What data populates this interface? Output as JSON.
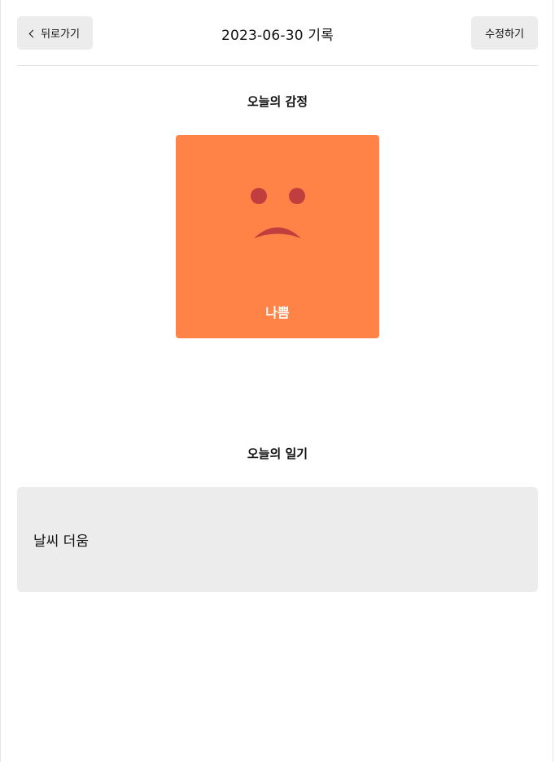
{
  "header": {
    "back_label": "뒤로가기",
    "title": "2023-06-30 기록",
    "edit_label": "수정하기"
  },
  "emotion": {
    "section_title": "오늘의 감정",
    "label": "나쁨",
    "card_color": "#ff8347",
    "face_color": "#c13e3e"
  },
  "diary": {
    "section_title": "오늘의 일기",
    "content": "날씨 더움"
  }
}
